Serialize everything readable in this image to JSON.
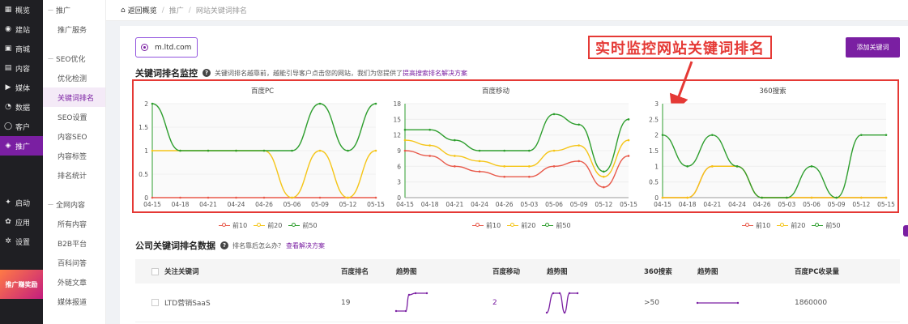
{
  "nav_primary": [
    {
      "label": "概览",
      "icon": "grid-icon"
    },
    {
      "label": "建站",
      "icon": "globe-icon"
    },
    {
      "label": "商城",
      "icon": "shop-icon"
    },
    {
      "label": "内容",
      "icon": "doc-icon"
    },
    {
      "label": "媒体",
      "icon": "media-icon"
    },
    {
      "label": "数据",
      "icon": "chart-icon"
    },
    {
      "label": "客户",
      "icon": "user-icon"
    },
    {
      "label": "推广",
      "icon": "promote-icon",
      "active": true
    },
    {
      "label": "启动",
      "icon": "launch-icon"
    },
    {
      "label": "应用",
      "icon": "apps-icon"
    },
    {
      "label": "设置",
      "icon": "gear-icon"
    }
  ],
  "promo_banner": "推广赚奖励",
  "nav_secondary": {
    "group1": "推广",
    "item_service": "推广服务",
    "group2": "SEO优化",
    "items_seo": [
      "优化检测",
      "关键词排名",
      "SEO设置",
      "内容SEO",
      "内容标签",
      "排名统计"
    ],
    "group3": "全网内容",
    "items_net": [
      "所有内容",
      "B2B平台",
      "百科问答",
      "外链文章",
      "媒体报道"
    ]
  },
  "breadcrumb": {
    "home": "返回概览",
    "sep": "/",
    "level1": "推广",
    "level2": "网站关键词排名"
  },
  "site": "m.ltd.com",
  "add_button": "添加关键词",
  "callout": "实时监控网站关键词排名",
  "monitor": {
    "title": "关键词排名监控",
    "desc": "关键词排名越靠前，越能引导客户点击您的网站，我们为您提供了",
    "link": "提高搜索排名解决方案"
  },
  "colors": {
    "accent": "#7a1fa2",
    "top10": "#e8594a",
    "top20": "#f5c518",
    "top50": "#2e9e2e",
    "callout": "#e53935"
  },
  "legend": [
    "前10",
    "前20",
    "前50"
  ],
  "chart_data": [
    {
      "type": "line",
      "title": "百度PC",
      "x": [
        "04-15",
        "04-18",
        "04-21",
        "04-24",
        "04-26",
        "05-06",
        "05-09",
        "05-12",
        "05-15"
      ],
      "yticks": [
        "0",
        "0.5",
        "1",
        "1.5",
        "2"
      ],
      "ylim": [
        0,
        2
      ],
      "series": [
        {
          "name": "前10",
          "values": [
            0,
            0,
            0,
            0,
            0,
            0,
            0,
            0,
            0
          ]
        },
        {
          "name": "前20",
          "values": [
            1,
            1,
            1,
            1,
            1,
            0,
            1,
            0,
            1
          ]
        },
        {
          "name": "前50",
          "values": [
            2,
            1,
            1,
            1,
            1,
            1,
            2,
            1,
            2
          ]
        }
      ]
    },
    {
      "type": "line",
      "title": "百度移动",
      "x": [
        "04-15",
        "04-18",
        "04-21",
        "04-24",
        "04-26",
        "05-03",
        "05-06",
        "05-09",
        "05-12",
        "05-15"
      ],
      "yticks": [
        "0",
        "3",
        "6",
        "9",
        "12",
        "15",
        "18"
      ],
      "ylim": [
        0,
        18
      ],
      "series": [
        {
          "name": "前10",
          "values": [
            9,
            8,
            6,
            5,
            4,
            4,
            6,
            7,
            2,
            8
          ]
        },
        {
          "name": "前20",
          "values": [
            11,
            10,
            8,
            7,
            6,
            6,
            9,
            10,
            4,
            11
          ]
        },
        {
          "name": "前50",
          "values": [
            13,
            13,
            11,
            9,
            9,
            9,
            16,
            14,
            5,
            15
          ]
        }
      ]
    },
    {
      "type": "line",
      "title": "360搜索",
      "x": [
        "04-15",
        "04-18",
        "04-21",
        "04-24",
        "04-26",
        "05-03",
        "05-06",
        "05-09",
        "05-12",
        "05-15"
      ],
      "yticks": [
        "0",
        "0.5",
        "1",
        "1.5",
        "2",
        "2.5",
        "3"
      ],
      "ylim": [
        0,
        3
      ],
      "series": [
        {
          "name": "前10",
          "values": [
            0,
            0,
            1,
            1,
            0,
            0,
            0,
            0,
            0,
            0
          ]
        },
        {
          "name": "前20",
          "values": [
            0,
            0,
            1,
            1,
            0,
            0,
            0,
            0,
            0,
            0
          ]
        },
        {
          "name": "前50",
          "values": [
            2,
            1,
            2,
            1,
            0,
            0,
            1,
            0,
            2,
            2
          ]
        }
      ]
    }
  ],
  "company": {
    "title": "公司关键词排名数据",
    "question": "排名靠后怎么办？",
    "link": "查看解决方案"
  },
  "table": {
    "headers": [
      "关注关键词",
      "百度排名",
      "趋势图",
      "百度移动",
      "趋势图",
      "360搜索",
      "趋势图",
      "百度PC收录量"
    ],
    "rows": [
      {
        "keyword": "LTD营销SaaS",
        "baidu": "19",
        "mobile": "2",
        "s360": ">50",
        "indexed": "1860000"
      }
    ]
  }
}
